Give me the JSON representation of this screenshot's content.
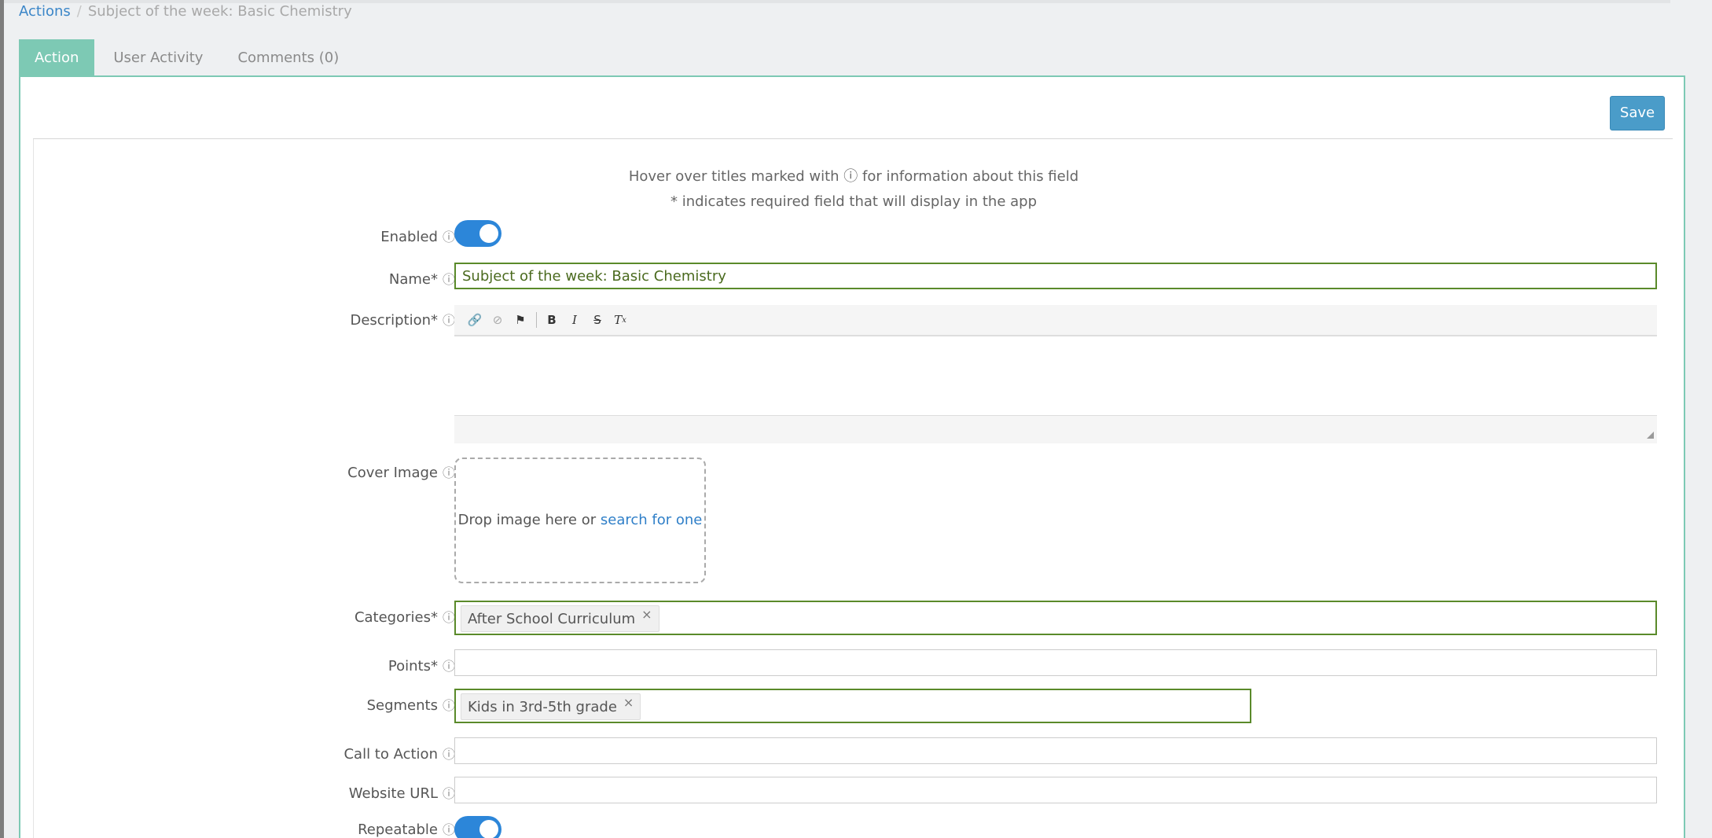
{
  "breadcrumb": {
    "root": "Actions",
    "separator": "/",
    "current": "Subject of the week: Basic Chemistry"
  },
  "tabs": [
    {
      "label": "Action",
      "active": true
    },
    {
      "label": "User Activity",
      "active": false
    },
    {
      "label": "Comments (0)",
      "active": false
    }
  ],
  "toolbar": {
    "save_label": "Save"
  },
  "hints": {
    "hover": "Hover over titles marked with ⓘ for information about this field",
    "required": "* indicates required field that will display in the app"
  },
  "fields": {
    "enabled": {
      "label": "Enabled",
      "value": true
    },
    "name": {
      "label": "Name*",
      "value": "Subject of the week: Basic Chemistry"
    },
    "description": {
      "label": "Description*",
      "value": ""
    },
    "cover_image": {
      "label": "Cover Image",
      "drop_text": "Drop image here or",
      "search_link": "search for one"
    },
    "categories": {
      "label": "Categories*",
      "values": [
        "After School Curriculum"
      ]
    },
    "points": {
      "label": "Points*",
      "value": ""
    },
    "segments": {
      "label": "Segments",
      "values": [
        "Kids in 3rd-5th grade"
      ]
    },
    "call_to_action": {
      "label": "Call to Action",
      "value": ""
    },
    "website_url": {
      "label": "Website URL",
      "value": ""
    },
    "repeatable": {
      "label": "Repeatable",
      "value": true
    }
  },
  "info_glyph": "ⓘ",
  "remove_glyph": "×",
  "editor_toolbar": [
    "link-icon",
    "unlink-icon",
    "anchor-icon",
    "bold-icon",
    "italic-icon",
    "strikethrough-icon",
    "remove-format-icon"
  ],
  "colors": {
    "accent": "#7dc9b4",
    "primary": "#4a9cc9",
    "link": "#3b86c8",
    "toggle_on": "#2c86d9",
    "valid_border": "#5a8a2a"
  }
}
